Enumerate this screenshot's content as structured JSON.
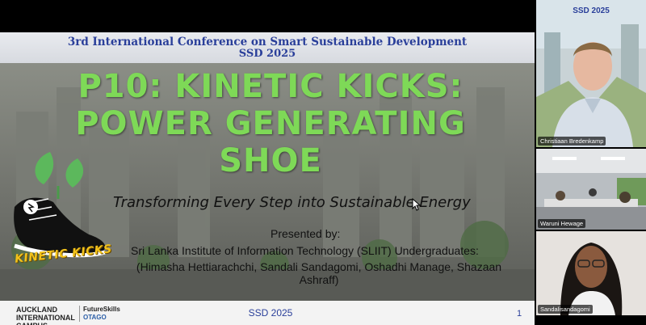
{
  "slide": {
    "conference_title": "3rd International Conference on Smart Sustainable Development",
    "conference_sub": "SSD 2025",
    "title_lines": [
      "P10: KINETIC KICKS:",
      "POWER GENERATING",
      "SHOE"
    ],
    "tagline": "Transforming Every Step into Sustainable Energy",
    "presented_by": "Presented by:",
    "institution": "Sri Lanka Institute of Information Technology (SLIIT) Undergraduates:",
    "authors": "(Himasha Hettiarachchi, Sandali Sandagomi, Oshadhi Manage, Shazaan Ashraff)",
    "logo_text": "KINETIC KICKS",
    "footer": {
      "logo_a": "AUCKLAND INTERNATIONAL CAMPUS",
      "logo_b_top": "FutureSkills",
      "logo_b_bottom": "OTAGO",
      "center": "SSD 2025",
      "page": "1"
    },
    "colors": {
      "title": "#7ed957",
      "header_text": "#2a3f9a",
      "logo_text": "#f3c21a"
    }
  },
  "participants": [
    {
      "name": "Christiaan Bredenkamp",
      "banner": "SSD 2025"
    },
    {
      "name": "Waruni Hewage"
    },
    {
      "name": "Sandalisandagomi"
    }
  ]
}
